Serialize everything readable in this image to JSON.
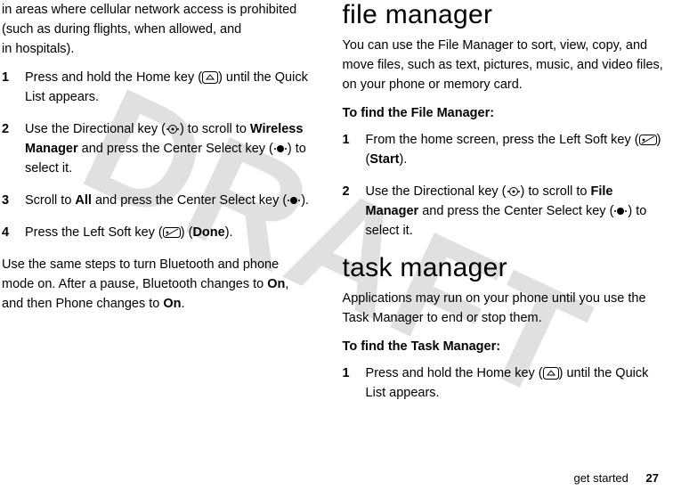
{
  "left": {
    "intro": "in areas where cellular network access is prohibited (such as during flights, when allowed, and in hospitals).",
    "steps": [
      {
        "n": "1",
        "before": "Press and hold the Home key (",
        "after": ") until the Quick List appears."
      },
      {
        "n": "2",
        "before": "Use the Directional key (",
        "mid1": ") to scroll to ",
        "bold1": "Wireless Manager",
        "mid2": " and press the Center Select key (",
        "after": ") to select it."
      },
      {
        "n": "3",
        "before": "Scroll to ",
        "bold1": "All",
        "mid1": " and press the Center Select key (",
        "after": ")."
      },
      {
        "n": "4",
        "before": "Press the Left Soft key (",
        "mid1": ") (",
        "bold1": "Done",
        "after": ")."
      }
    ],
    "outro_a": "Use the same steps to turn Bluetooth and phone mode on. After a pause, Bluetooth changes to ",
    "outro_bold1": "On",
    "outro_b": ", and then Phone changes to ",
    "outro_bold2": "On",
    "outro_c": "."
  },
  "right": {
    "h_file": "file manager",
    "file_intro": "You can use the File Manager to sort, view, copy, and move files, such as text, pictures, music, and video files, on your phone or memory card.",
    "file_lead": "To find the File Manager:",
    "file_steps": [
      {
        "n": "1",
        "before": "From the home screen, press the Left Soft key (",
        "mid1": ") (",
        "bold1": "Start",
        "after": ")."
      },
      {
        "n": "2",
        "before": "Use the Directional key (",
        "mid1": ") to scroll to ",
        "bold1": "File Manager",
        "mid2": " and press the Center Select key (",
        "after": ") to select it."
      }
    ],
    "h_task": "task manager",
    "task_intro": "Applications may run on your phone until you use the Task Manager to end or stop them.",
    "task_lead": "To find the Task Manager:",
    "task_steps": [
      {
        "n": "1",
        "before": "Press and hold the Home key (",
        "after": ") until the Quick List appears."
      }
    ]
  },
  "footer": {
    "section": "get started",
    "page": "27"
  }
}
